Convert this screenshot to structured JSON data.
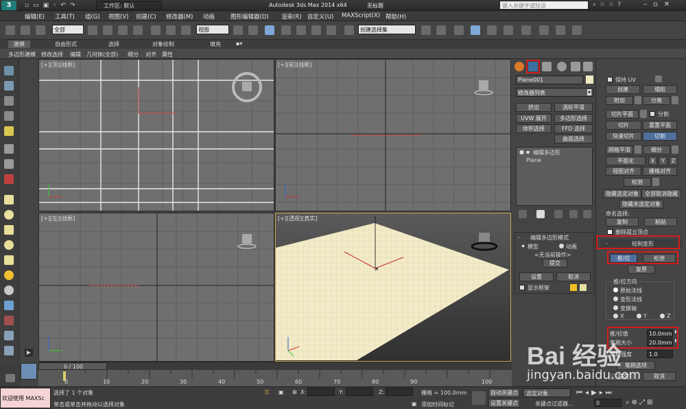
{
  "titlebar": {
    "workspace_label": "工作区: 默认",
    "title": "Autodesk 3ds Max  2014 x64",
    "doc": "无标题",
    "search_placeholder": "键入关键字或短语"
  },
  "menu": [
    "编辑(E)",
    "工具(T)",
    "组(G)",
    "视图(V)",
    "创建(C)",
    "修改器(M)",
    "动画",
    "图形编辑器(D)",
    "渲染(R)",
    "自定义(U)",
    "MAXScript(X)",
    "帮助(H)"
  ],
  "toolbar": {
    "filter": "全部",
    "refcoord": "视图",
    "selset": "创建选择集"
  },
  "ribbon": {
    "tabs": [
      "建模",
      "自由形式",
      "选择",
      "对象绘制",
      "填充"
    ],
    "panel": [
      "多边形建模",
      "修改选择",
      "编辑",
      "几何体(全部)",
      "细分",
      "对齐",
      "属性"
    ]
  },
  "viewports": {
    "top": "[+][顶][线框]",
    "front": "[+][前][线框]",
    "left": "[+][左][线框]",
    "persp": "[+][透视][真实]"
  },
  "cmdpanel": {
    "object_name": "Plane001",
    "modifier_list": "修改器列表",
    "mod_buttons": [
      "挤出",
      "涡轮平滑",
      "UVW 展开",
      "多边形选择",
      "体积选择",
      "FFD 选择",
      "曲面选择"
    ],
    "stack": [
      "编辑多边形",
      "Plane"
    ],
    "mode_title": "编辑多边形模式",
    "model": "模型",
    "anim": "动画",
    "no_op": "<无当前操作>",
    "commit": "提交",
    "settings": "设置",
    "cancel": "取消",
    "show_cage": "显示框架"
  },
  "rightroll": {
    "preserve_uv": "保持 UV",
    "create": "创建",
    "collapse": "塌陷",
    "attach": "附加",
    "detach": "分离",
    "slice_plane": "切片平面",
    "split": "分割",
    "slice": "切片",
    "reset_plane": "重置平面",
    "quickslice": "快速切片",
    "cut": "切割",
    "meshsmooth": "网格平滑",
    "tessellate": "细分",
    "make_planar": "平面化",
    "x": "X",
    "y": "Y",
    "z": "Z",
    "view_align": "视图对齐",
    "grid_align": "栅格对齐",
    "relax": "松弛",
    "hide_sel": "隐藏选定对象",
    "unhide_all": "全部取消隐藏",
    "hide_unsel": "隐藏未选定对象",
    "named_sel": "命名选择:",
    "copy": "复制",
    "paste": "粘贴",
    "delete_iso": "删除孤立顶点",
    "paint_deform": "绘制变形",
    "pushpull": "推/拉",
    "relax2": "松弛",
    "revert": "复原",
    "pp_dir": "推/拉方向",
    "orig_normals": "原始法线",
    "deformed_normals": "变形法线",
    "transform_axis": "变换轴",
    "px": "X",
    "py": "Y",
    "pz": "Z",
    "pp_value_label": "推/拉值",
    "pp_value": "10.0mm",
    "brush_size_label": "笔刷大小",
    "brush_size": "20.0mm",
    "brush_strength_label": "笔刷强度",
    "brush_strength": "1.0",
    "brush_options": "笔刷选项",
    "commit": "提交",
    "cancel": "取消"
  },
  "timeline": {
    "frame": "0 / 100",
    "ticks": [
      "0",
      "10",
      "20",
      "30",
      "40",
      "50",
      "60",
      "70",
      "80",
      "90",
      "100"
    ]
  },
  "status": {
    "welcome": "欢迎使用 MAXSc",
    "selected": "选择了 1 个对象",
    "hint": "单击或单击并拖动以选择对象",
    "x": "X:",
    "y": "Y:",
    "z": "Z:",
    "grid": "栅格 = 100.0mm",
    "add_tag": "添加时间标记",
    "autokey": "自动关键点",
    "setkey": "设置关键点",
    "selected_obj": "选定对象",
    "keyfilters": "关键点过滤器...",
    "frame": "0"
  },
  "watermark": {
    "text": "Bai 经验",
    "url": "jingyan.baidu.com"
  }
}
